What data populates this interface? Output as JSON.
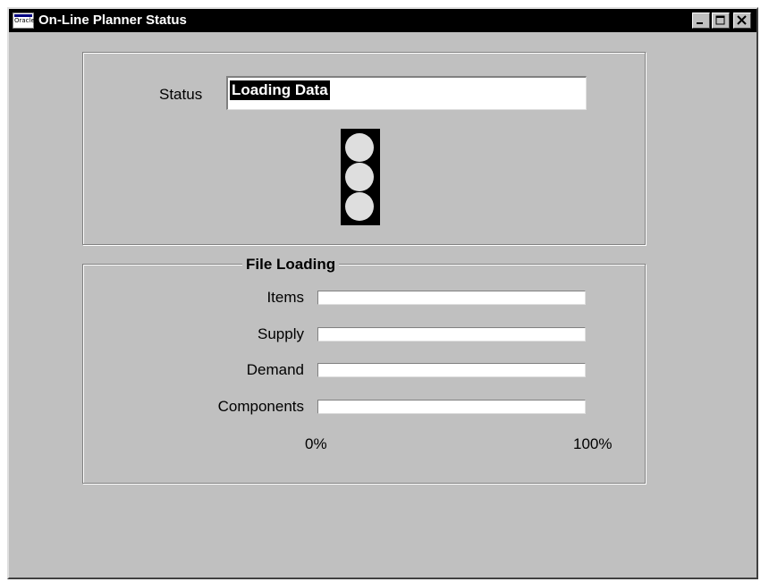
{
  "window": {
    "title": "On-Line Planner Status",
    "app_icon_text": "Oracle"
  },
  "status_section": {
    "label": "Status",
    "value": "Loading Data",
    "traffic_light": {
      "colors": [
        "#dedede",
        "#dedede",
        "#dedede"
      ],
      "active": "none"
    }
  },
  "file_loading": {
    "title": "File Loading",
    "rows": [
      {
        "label": "Items",
        "progress": 0
      },
      {
        "label": "Supply",
        "progress": 0
      },
      {
        "label": "Demand",
        "progress": 0
      },
      {
        "label": "Components",
        "progress": 0
      }
    ],
    "scale_min_label": "0%",
    "scale_max_label": "100%"
  },
  "colors": {
    "window_bg": "#c0c0c0",
    "titlebar_bg": "#000000",
    "selection_bg": "#000000",
    "progress_fill": "#000080"
  }
}
